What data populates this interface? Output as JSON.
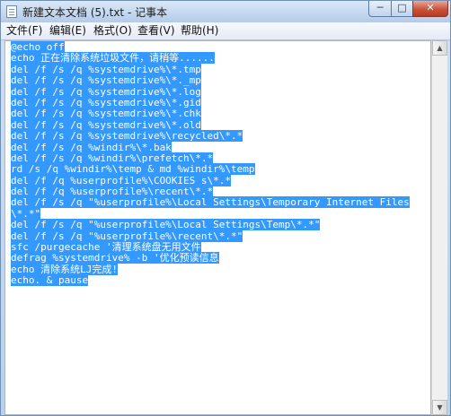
{
  "window": {
    "title": "新建文本文档 (5).txt - 记事本",
    "controls": {
      "minimize": "─",
      "maximize": "□",
      "close": "✕"
    }
  },
  "menu": {
    "items": [
      "文件(F)",
      "编辑(E)",
      "格式(O)",
      "查看(V)",
      "帮助(H)"
    ]
  },
  "editor": {
    "selected": true,
    "lines": [
      "@echo off",
      "echo 正在清除系统垃圾文件，请稍等......",
      "del /f /s /q %systemdrive%\\*.tmp",
      "del /f /s /q %systemdrive%\\*._mp",
      "del /f /s /q %systemdrive%\\*.log",
      "del /f /s /q %systemdrive%\\*.gid",
      "del /f /s /q %systemdrive%\\*.chk",
      "del /f /s /q %systemdrive%\\*.old",
      "del /f /s /q %systemdrive%\\recycled\\*.*",
      "del /f /s /q %windir%\\*.bak",
      "del /f /s /q %windir%\\prefetch\\*.*",
      "rd /s /q %windir%\\temp & md %windir%\\temp",
      "del /f /q %userprofile%\\COOKIES s\\*.*",
      "del /f /q %userprofile%\\recent\\*.*",
      "del /f /s /q \"%userprofile%\\Local Settings\\Temporary Internet Files",
      "\\*.*\"",
      "del /f /s /q \"%userprofile%\\Local Settings\\Temp\\*.*\"",
      "del /f /s /q \"%userprofile%\\recent\\*.*\"",
      "sfc /purgecache '清理系统盘无用文件",
      "defrag %systemdrive% -b '优化预读信息",
      "echo 清除系统LJ完成!",
      "echo. & pause"
    ]
  },
  "scrollbar": {
    "up_arrow": "▲",
    "down_arrow": "▼"
  }
}
